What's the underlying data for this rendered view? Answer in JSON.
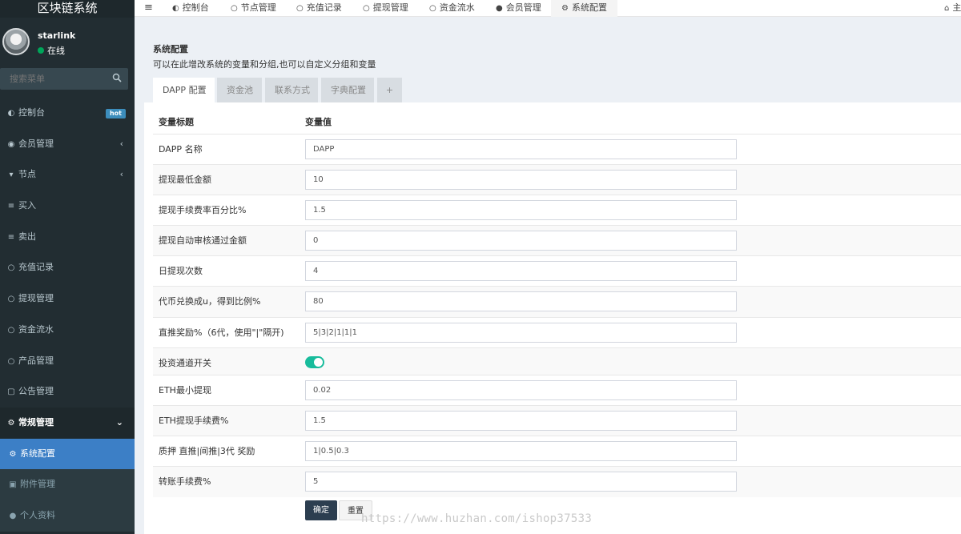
{
  "app": {
    "brand": "区块链系统"
  },
  "user": {
    "name": "starlink",
    "status": "在线"
  },
  "search": {
    "placeholder": "搜索菜单"
  },
  "sidebar": {
    "items": [
      {
        "label": "控制台",
        "icon": "dashboard-icon",
        "badge": "hot"
      },
      {
        "label": "会员管理",
        "icon": "user-circle-icon",
        "chevron": "‹"
      },
      {
        "label": "节点",
        "icon": "trash-icon",
        "chevron": "‹"
      },
      {
        "label": "买入",
        "icon": "list-icon"
      },
      {
        "label": "卖出",
        "icon": "list-icon"
      },
      {
        "label": "充值记录",
        "icon": "circle-icon"
      },
      {
        "label": "提现管理",
        "icon": "circle-icon"
      },
      {
        "label": "资金流水",
        "icon": "circle-icon"
      },
      {
        "label": "产品管理",
        "icon": "circle-icon"
      },
      {
        "label": "公告管理",
        "icon": "file-icon"
      },
      {
        "label": "常规管理",
        "icon": "cogs-icon",
        "chevron": "⌄"
      },
      {
        "label": "系统配置",
        "icon": "gear-icon"
      },
      {
        "label": "附件管理",
        "icon": "image-icon"
      },
      {
        "label": "个人资料",
        "icon": "user-icon"
      }
    ]
  },
  "topnav": {
    "items": [
      {
        "label": "控制台",
        "icon": "dashboard-icon"
      },
      {
        "label": "节点管理",
        "icon": "circle-icon"
      },
      {
        "label": "充值记录",
        "icon": "circle-icon"
      },
      {
        "label": "提现管理",
        "icon": "circle-icon"
      },
      {
        "label": "资金流水",
        "icon": "circle-icon"
      },
      {
        "label": "会员管理",
        "icon": "user-icon"
      },
      {
        "label": "系统配置",
        "icon": "gear-icon"
      }
    ],
    "right_text": "主"
  },
  "page": {
    "title": "系统配置",
    "subtitle": "可以在此增改系统的变量和分组,也可以自定义分组和变量"
  },
  "tabs": [
    {
      "label": "DAPP 配置"
    },
    {
      "label": "资金池"
    },
    {
      "label": "联系方式"
    },
    {
      "label": "字典配置"
    },
    {
      "label": "+"
    }
  ],
  "table": {
    "headers": [
      "变量标题",
      "变量值"
    ],
    "rows": [
      {
        "label": "DAPP 名称",
        "value": "DAPP"
      },
      {
        "label": "提现最低金额",
        "value": "10"
      },
      {
        "label": "提现手续费率百分比%",
        "value": "1.5"
      },
      {
        "label": "提现自动审核通过金额",
        "value": "0"
      },
      {
        "label": "日提现次数",
        "value": "4"
      },
      {
        "label": "代币兑换成u，得到比例%",
        "value": "80"
      },
      {
        "label": "直推奖励%（6代，使用\"|\"隔开)",
        "value": "5|3|2|1|1|1"
      },
      {
        "label": "投资通道开关",
        "type": "switch",
        "value": "on"
      },
      {
        "label": "ETH最小提现",
        "value": "0.02"
      },
      {
        "label": "ETH提现手续费%",
        "value": "1.5"
      },
      {
        "label": "质押 直推|间推|3代 奖励",
        "value": "1|0.5|0.3"
      },
      {
        "label": "转账手续费%",
        "value": "5"
      }
    ]
  },
  "buttons": {
    "submit": "确定",
    "reset": "重置"
  },
  "watermark": "https://www.huzhan.com/ishop37533",
  "colors": {
    "sidebar_bg": "#222d32",
    "active_menu": "#3c7fc6",
    "switch_on": "#18bc9c",
    "primary_btn": "#2c3e50"
  }
}
